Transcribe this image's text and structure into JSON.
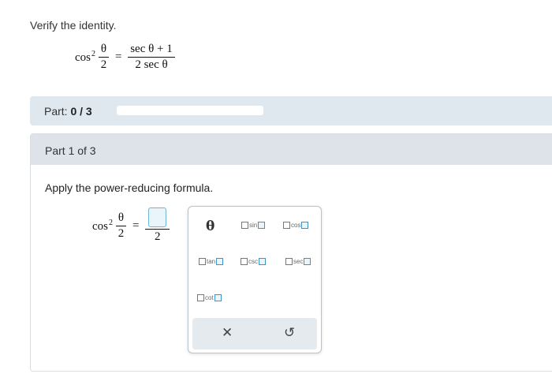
{
  "question": {
    "prompt": "Verify the identity.",
    "lhs_fn": "cos",
    "lhs_exp": "2",
    "lhs_num": "θ",
    "lhs_den": "2",
    "eq": "=",
    "rhs_num": "sec θ + 1",
    "rhs_den": "2 sec θ"
  },
  "part_status": {
    "label": "Part:",
    "value": "0 / 3",
    "progress": 0.0,
    "progress_color": "#3a8dbf"
  },
  "part": {
    "title": "Part 1 of 3",
    "instruction": "Apply the power-reducing formula.",
    "answer": {
      "fn": "cos",
      "exp": "2",
      "num": "θ",
      "den": "2",
      "eq": "=",
      "rhs_den": "2"
    }
  },
  "palette": {
    "theta": "θ",
    "buttons": [
      {
        "id": "sin",
        "label": "sin"
      },
      {
        "id": "cos",
        "label": "cos"
      },
      {
        "id": "tan",
        "label": "tan"
      },
      {
        "id": "csc",
        "label": "csc"
      },
      {
        "id": "sec",
        "label": "sec"
      },
      {
        "id": "cot",
        "label": "cot"
      }
    ],
    "clear_icon": "✕",
    "undo_icon": "↺",
    "accent": "#3a95c9"
  }
}
